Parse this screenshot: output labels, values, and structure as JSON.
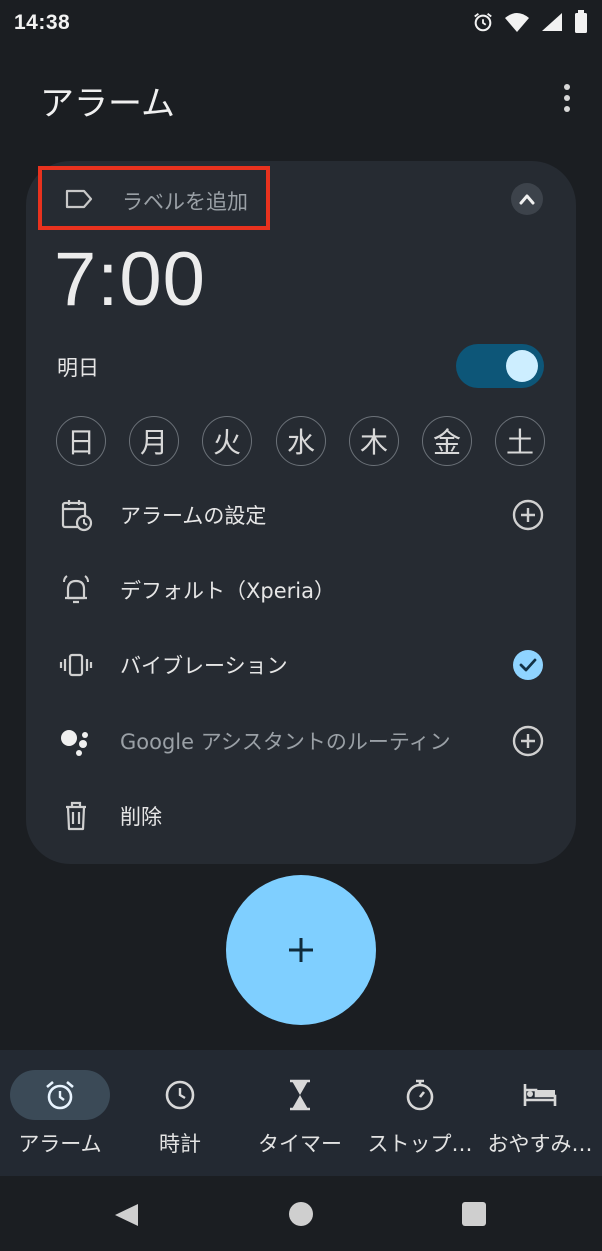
{
  "status_bar": {
    "time": "14:38"
  },
  "header": {
    "title": "アラーム"
  },
  "alarm": {
    "label_placeholder": "ラベルを追加",
    "time": "7:00",
    "day": "明日",
    "enabled": true,
    "weekdays": [
      "日",
      "月",
      "火",
      "水",
      "木",
      "金",
      "土"
    ],
    "options": {
      "settings": "アラームの設定",
      "sound": "デフォルト（Xperia）",
      "vibration": "バイブレーション",
      "vibration_checked": true,
      "assistant": "Google アシスタントのルーティン",
      "delete": "削除"
    }
  },
  "fab": {
    "icon": "plus-icon"
  },
  "bottom_nav": {
    "items": [
      {
        "label": "アラーム",
        "icon": "alarm-clock-icon",
        "active": true
      },
      {
        "label": "時計",
        "icon": "clock-icon",
        "active": false
      },
      {
        "label": "タイマー",
        "icon": "hourglass-icon",
        "active": false
      },
      {
        "label": "ストップ…",
        "icon": "stopwatch-icon",
        "active": false
      },
      {
        "label": "おやすみ…",
        "icon": "bed-icon",
        "active": false
      }
    ]
  },
  "colors": {
    "background": "#1b1e22",
    "card": "#262b32",
    "accent": "#7fcfff",
    "toggle_track": "#0d5678",
    "highlight_box": "#e8321e"
  }
}
